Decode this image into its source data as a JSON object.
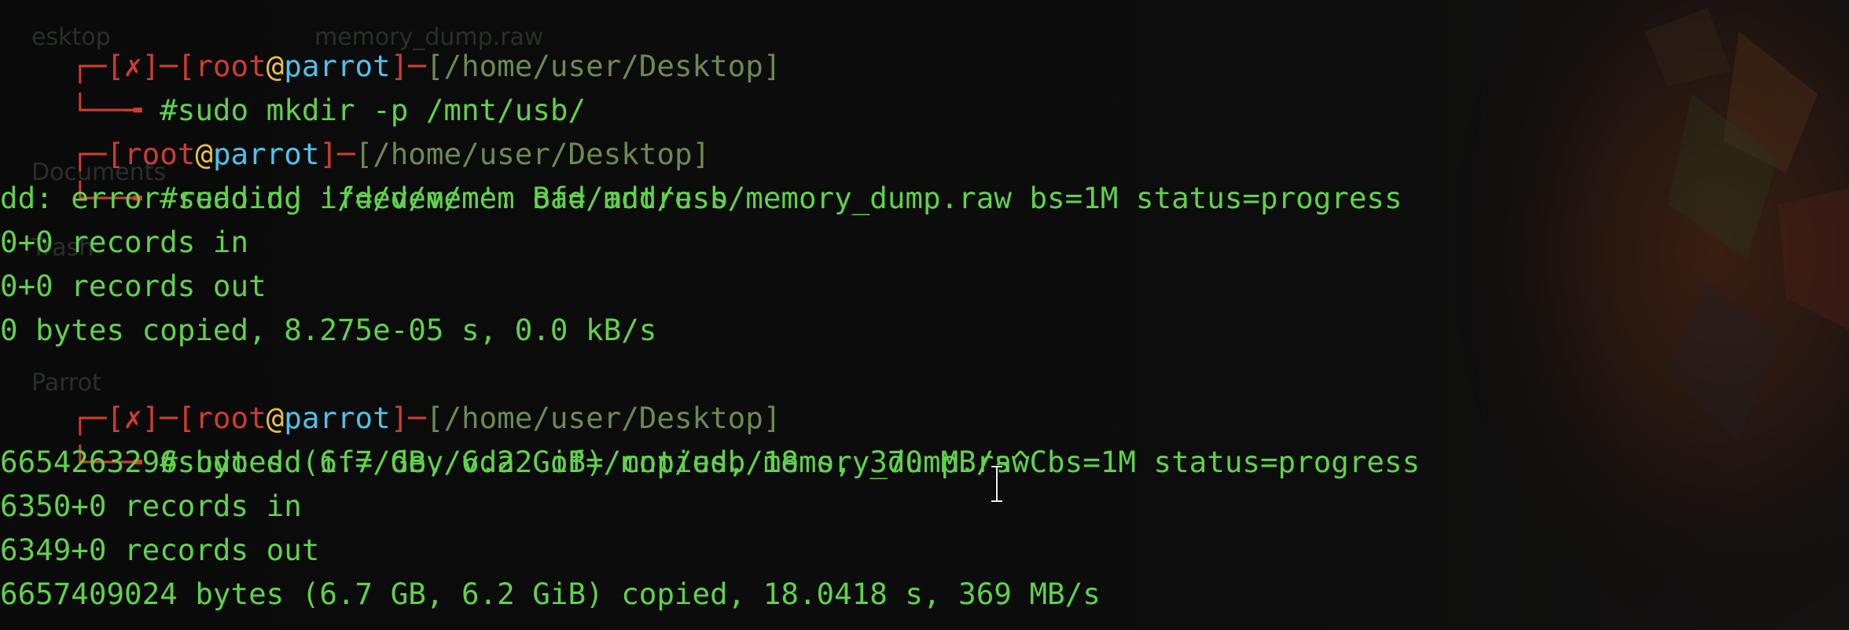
{
  "background_wallpaper": {
    "visible_ghost_labels": [
      "esktop",
      "memory_dump.raw",
      "Documents",
      "Trash",
      "Parrot"
    ]
  },
  "colors": {
    "frame": "#d23b2f",
    "user": "#cf3b30",
    "at": "#e8c43a",
    "host": "#4fc1e9",
    "path": "#6b8a52",
    "command": "#5fd24a"
  },
  "prompts": [
    {
      "status": "[✗]",
      "user": "root",
      "at": "@",
      "host": "parrot",
      "path": "[/home/user/Desktop]",
      "command": "#sudo mkdir -p /mnt/usb/"
    },
    {
      "status": "",
      "user": "root",
      "at": "@",
      "host": "parrot",
      "path": "[/home/user/Desktop]",
      "command": "#sudo dd if=/dev/mem of=/mnt/usb/memory_dump.raw bs=1M status=progress"
    },
    {
      "status": "[✗]",
      "user": "root",
      "at": "@",
      "host": "parrot",
      "path": "[/home/user/Desktop]",
      "command": "#sudo dd if=/dev/vda2 of=/mnt/usb/memory_dump.raw bs=1M status=progress"
    }
  ],
  "output": {
    "block1": [
      "dd: error reading '/dev/mem': Bad address",
      "0+0 records in",
      "0+0 records out",
      "0 bytes copied, 8.275e-05 s, 0.0 kB/s"
    ],
    "block2": [
      "6654263296 bytes (6.7 GB, 6.2 GiB) copied, 18 s, 370 MB/s^C",
      "6350+0 records in",
      "6349+0 records out",
      "6657409024 bytes (6.7 GB, 6.2 GiB) copied, 18.0418 s, 369 MB/s"
    ]
  }
}
